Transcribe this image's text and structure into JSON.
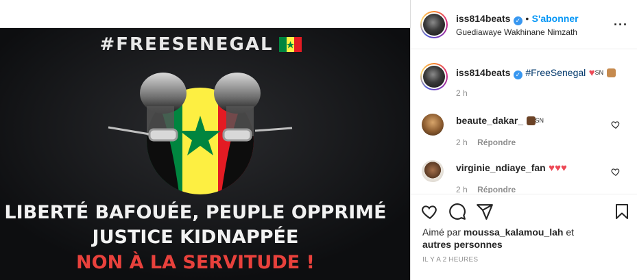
{
  "post": {
    "image_text": {
      "hashtag": "#FREESENEGAL",
      "line1": "LIBERTÉ BAFOUÉE, PEUPLE OPPRIMÉ",
      "line2": "JUSTICE KIDNAPPÉE",
      "line3": "NON À LA SERVITUDE !"
    }
  },
  "header": {
    "username": "iss814beats",
    "dot": "•",
    "follow_label": "S'abonner",
    "location": "Guediawaye Wakhinane Nimzath",
    "more_icon": "more-horizontal-icon"
  },
  "caption": {
    "username": "iss814beats",
    "hashtag": "#FreeSenegal",
    "sn": "SN",
    "time": "2 h"
  },
  "comments": [
    {
      "username": "beaute_dakar_",
      "sn": "SN",
      "time": "2 h",
      "reply_label": "Répondre"
    },
    {
      "username": "virginie_ndiaye_fan",
      "time": "2 h",
      "reply_label": "Répondre"
    }
  ],
  "actions": {
    "liked_prefix": "Aimé par",
    "liked_user": "moussa_kalamou_lah",
    "liked_suffix": "et",
    "liked_others": "autres personnes",
    "time_ago": "IL Y A 2 HEURES"
  },
  "colors": {
    "accent": "#0095f6",
    "heart": "#ed4956",
    "flag_green": "#00853f",
    "flag_yellow": "#fdef42",
    "flag_red": "#e31b23",
    "image_red": "#e8413c"
  }
}
